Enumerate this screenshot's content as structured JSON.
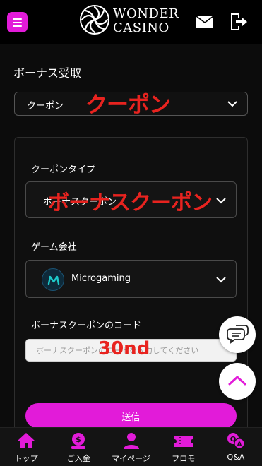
{
  "header": {
    "logo_text_line1": "WONDER",
    "logo_text_line2": "CASINO",
    "menu_icon": "hamburger-icon",
    "mail_icon": "mail-icon",
    "logout_icon": "logout-icon"
  },
  "page": {
    "title": "ボーナス受取"
  },
  "bonus_type_select": {
    "value": "クーポン"
  },
  "form": {
    "coupon_type_label": "クーポンタイプ",
    "coupon_type_value": "ボーナスクーポン",
    "game_provider_label": "ゲーム会社",
    "game_provider_value": "Microgaming",
    "coupon_code_label": "ボーナスクーポンのコード",
    "coupon_code_placeholder": "ボーナスクーポンのコードを入力してください",
    "submit_label": "送信"
  },
  "annotations": {
    "select_overlay": "クーポン",
    "coupon_type_overlay": "ボーナスクーポン",
    "code_overlay": "30nd"
  },
  "tabbar": {
    "items": [
      {
        "label": "トップ",
        "icon": "home-icon"
      },
      {
        "label": "ご入金",
        "icon": "deposit-icon"
      },
      {
        "label": "マイページ",
        "icon": "user-icon"
      },
      {
        "label": "プロモ",
        "icon": "ticket-icon"
      },
      {
        "label": "Q&A",
        "icon": "faq-icon"
      }
    ]
  },
  "colors": {
    "accent": "#e21bd9",
    "annotation_red": "#e8231f",
    "background": "#0c0c0c"
  }
}
